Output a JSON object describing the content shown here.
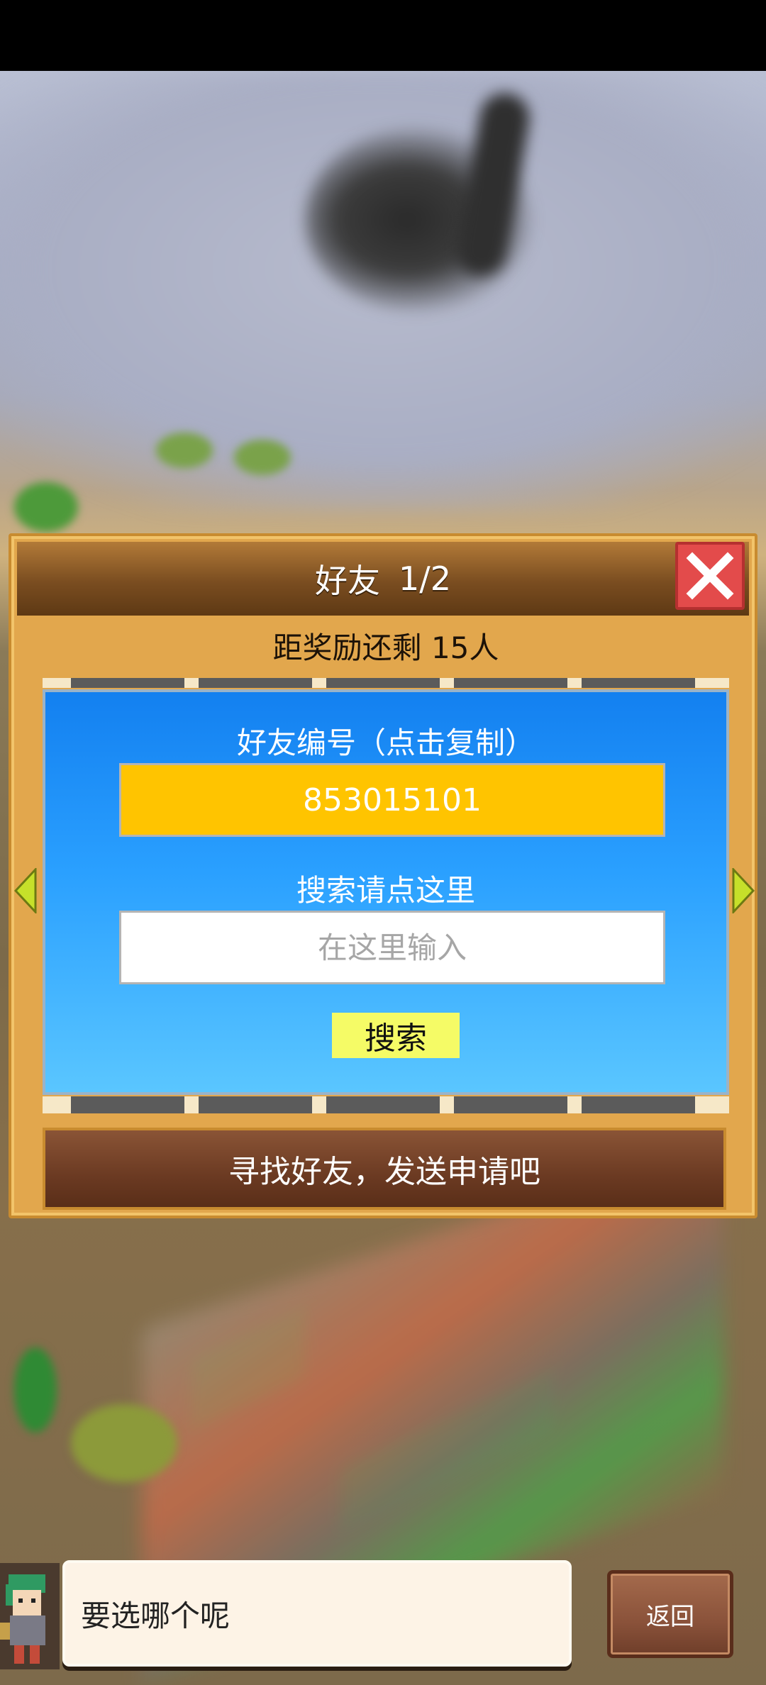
{
  "dialog": {
    "title": "好友",
    "page_indicator": "1/2",
    "reward_text": "距奖励还剩 15人",
    "friend_id_label": "好友编号（点击复制）",
    "friend_id": "853015101",
    "search_label": "搜索请点这里",
    "search_placeholder": "在这里输入",
    "search_button": "搜索",
    "send_request_text": "寻找好友，发送申请吧",
    "close_icon": "close-icon",
    "prev_icon": "arrow-left-icon",
    "next_icon": "arrow-right-icon"
  },
  "bottom_bar": {
    "message": "要选哪个呢",
    "back_button": "返回",
    "avatar_icon": "character-avatar"
  },
  "colors": {
    "panel_blue": "#1380f0",
    "id_yellow": "#ffc400",
    "search_button_yellow": "#f5fb66",
    "close_red": "#e34b4b",
    "dialog_gold": "#e2a74d",
    "header_brown": "#7a4d20"
  }
}
